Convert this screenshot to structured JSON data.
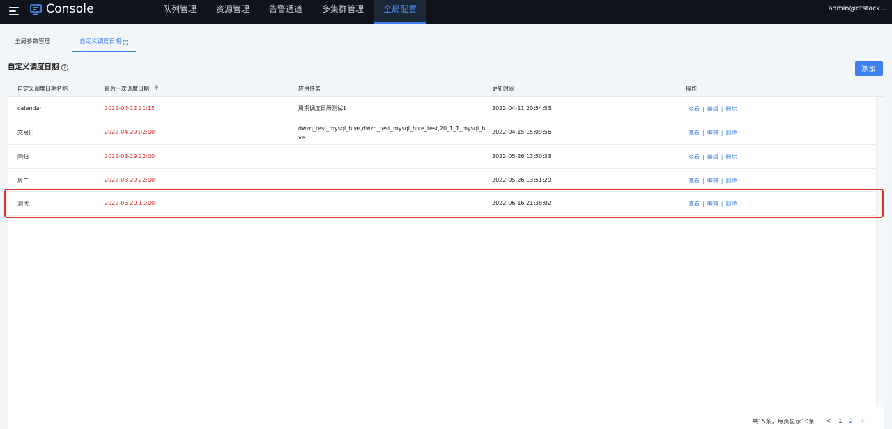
{
  "header": {
    "app_title": "Console",
    "nav": [
      "队列管理",
      "资源管理",
      "告警通道",
      "多集群管理",
      "全局配置"
    ],
    "active_nav": "全局配置",
    "user": "admin@dtstack..."
  },
  "tabs": [
    {
      "label": "全局参数管理"
    },
    {
      "label": "自定义调度日期",
      "help": "?"
    }
  ],
  "section": {
    "title": "自定义调度日期",
    "help": "?",
    "add_label": "添加"
  },
  "table": {
    "columns": [
      "自定义调度日期名称",
      "最后一次调度日期",
      "应用任务",
      "更新时间",
      "操作"
    ],
    "sort_icon": "sort-icon",
    "rows": [
      {
        "name": "calendar",
        "last_date": "2022-04-12 21:15",
        "task": "周期调度日历测试1",
        "updated": "2022-04-11 20:54:53"
      },
      {
        "name": "交易日",
        "last_date": "2022-04-29 02:00",
        "task": "dwzq_test_mysql_hive,dwzq_test_mysql_hive_test,20_1_1_mysql_hive",
        "updated": "2022-04-15 15:09:56"
      },
      {
        "name": "回归",
        "last_date": "2022-03-29 22:00",
        "task": "",
        "updated": "2022-05-26 13:50:33"
      },
      {
        "name": "周二",
        "last_date": "2022-03-29 22:00",
        "task": "",
        "updated": "2022-05-26 13:51:29"
      },
      {
        "name": "测试",
        "last_date": "2022-06-20 11:00",
        "task": "",
        "updated": "2022-06-16 21:38:02"
      }
    ],
    "ops": {
      "view": "查看",
      "edit": "编辑",
      "delete": "删除",
      "sep": "|"
    },
    "highlighted_row": 4
  },
  "pagination": {
    "total_text": "共15条，每页显示10条",
    "prev": "<",
    "next": ">",
    "pages": [
      "1",
      "2"
    ],
    "current": "1"
  },
  "colors": {
    "accent": "#3f7ff0",
    "date_red": "#e0262b",
    "topbar": "#0e131c",
    "highlight_border": "#d9362b"
  }
}
